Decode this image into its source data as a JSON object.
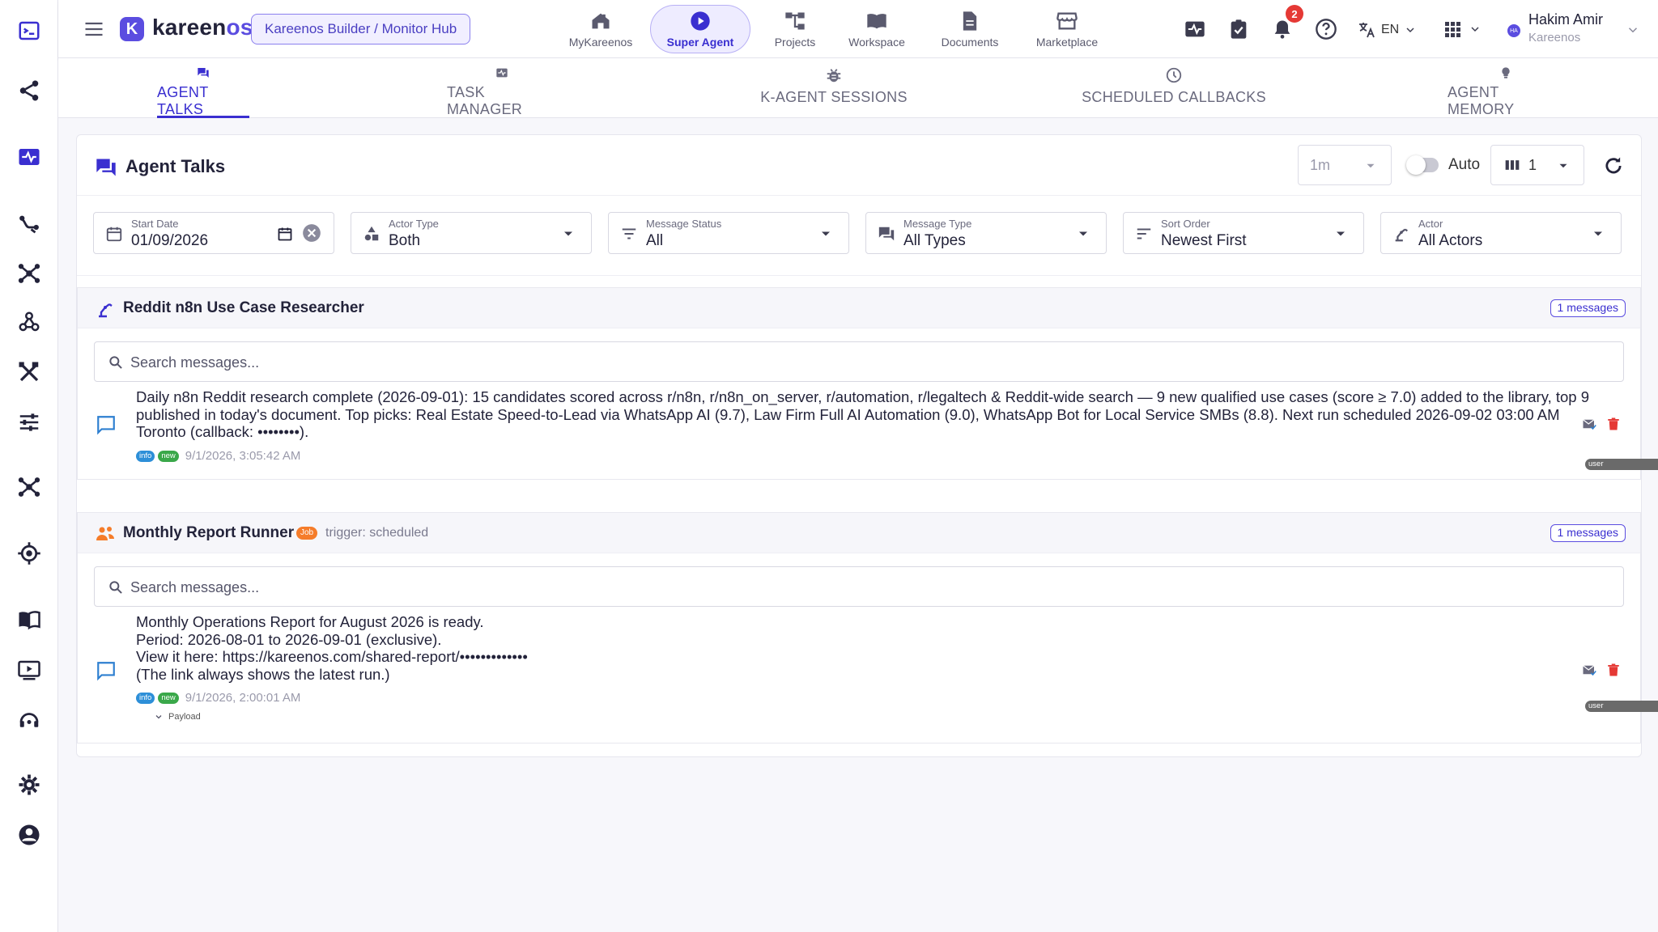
{
  "app": {
    "logo_letter": "K",
    "logo_main": "kareen",
    "logo_accent": "os",
    "hub_label": "Kareenos Builder / Monitor Hub"
  },
  "nav": [
    {
      "label": "MyKareenos",
      "icon": "home-icon"
    },
    {
      "label": "Super Agent",
      "icon": "play-circle-icon",
      "active": true
    },
    {
      "label": "Projects",
      "icon": "hierarchy-icon"
    },
    {
      "label": "Workspace",
      "icon": "book-open-icon"
    },
    {
      "label": "Documents",
      "icon": "document-icon"
    },
    {
      "label": "Marketplace",
      "icon": "storefront-icon"
    }
  ],
  "header": {
    "notification_count": "2",
    "language": "EN",
    "user": {
      "name": "Hakim Amir",
      "org": "Kareenos",
      "initials": "HA"
    }
  },
  "tabs": [
    {
      "label": "AGENT TALKS",
      "icon": "chat-icon",
      "active": true
    },
    {
      "label": "TASK MANAGER",
      "icon": "monitor-pulse-icon"
    },
    {
      "label": "K-AGENT SESSIONS",
      "icon": "bug-icon"
    },
    {
      "label": "SCHEDULED CALLBACKS",
      "icon": "clock-icon"
    },
    {
      "label": "AGENT MEMORY",
      "icon": "lightbulb-icon"
    }
  ],
  "panel": {
    "title": "Agent Talks",
    "interval": "1m",
    "auto_label": "Auto",
    "auto_enabled": false,
    "columns": "1"
  },
  "filters": {
    "start_date": {
      "label": "Start Date",
      "value": "01/09/2026"
    },
    "actor_type": {
      "label": "Actor Type",
      "value": "Both"
    },
    "message_status": {
      "label": "Message Status",
      "value": "All"
    },
    "message_type": {
      "label": "Message Type",
      "value": "All Types"
    },
    "sort_order": {
      "label": "Sort Order",
      "value": "Newest First"
    },
    "actor": {
      "label": "Actor",
      "value": "All Actors"
    }
  },
  "groups": [
    {
      "title": "Reddit n8n Use Case Researcher",
      "count": "1 messages",
      "search_placeholder": "Search messages...",
      "message": {
        "text": "Daily n8n Reddit research complete (2026-09-01): 15 candidates scored across r/n8n, r/n8n_on_server, r/automation, r/legaltech & Reddit-wide search — 9 new qualified use cases (score ≥ 7.0) added to the library, top 9 published in today's document. Top picks: Real Estate Speed-to-Lead via WhatsApp AI (9.7), Law Firm Full AI Automation (9.0), WhatsApp Bot for Local Service SMBs (8.8). Next run scheduled 2026-09-02 03:00 AM Toronto (callback: ••••••••).",
        "tags": [
          "info",
          "new",
          "user"
        ],
        "timestamp": "9/1/2026, 3:05:42 AM"
      }
    },
    {
      "title": "Monthly Report Runner",
      "job_badge": "Job",
      "trigger": "trigger: scheduled",
      "count": "1 messages",
      "search_placeholder": "Search messages...",
      "message": {
        "text": "Monthly Operations Report for August 2026 is ready.\nPeriod: 2026-08-01 to 2026-09-01 (exclusive).\nView it here: https://kareenos.com/shared-report/•••••••••••••\n(The link always shows the latest run.)",
        "tags": [
          "info",
          "new",
          "user"
        ],
        "timestamp": "9/1/2026, 2:00:01 AM",
        "payload_label": "Payload"
      }
    }
  ],
  "colors": {
    "accent": "#3a2fd0",
    "brand": "#5b4de0",
    "job_badge": "#f57c2a",
    "delete": "#e53935",
    "tag_info": "#2d8fd8",
    "tag_new": "#3aa84a",
    "tag_user": "#6a6a6a"
  }
}
